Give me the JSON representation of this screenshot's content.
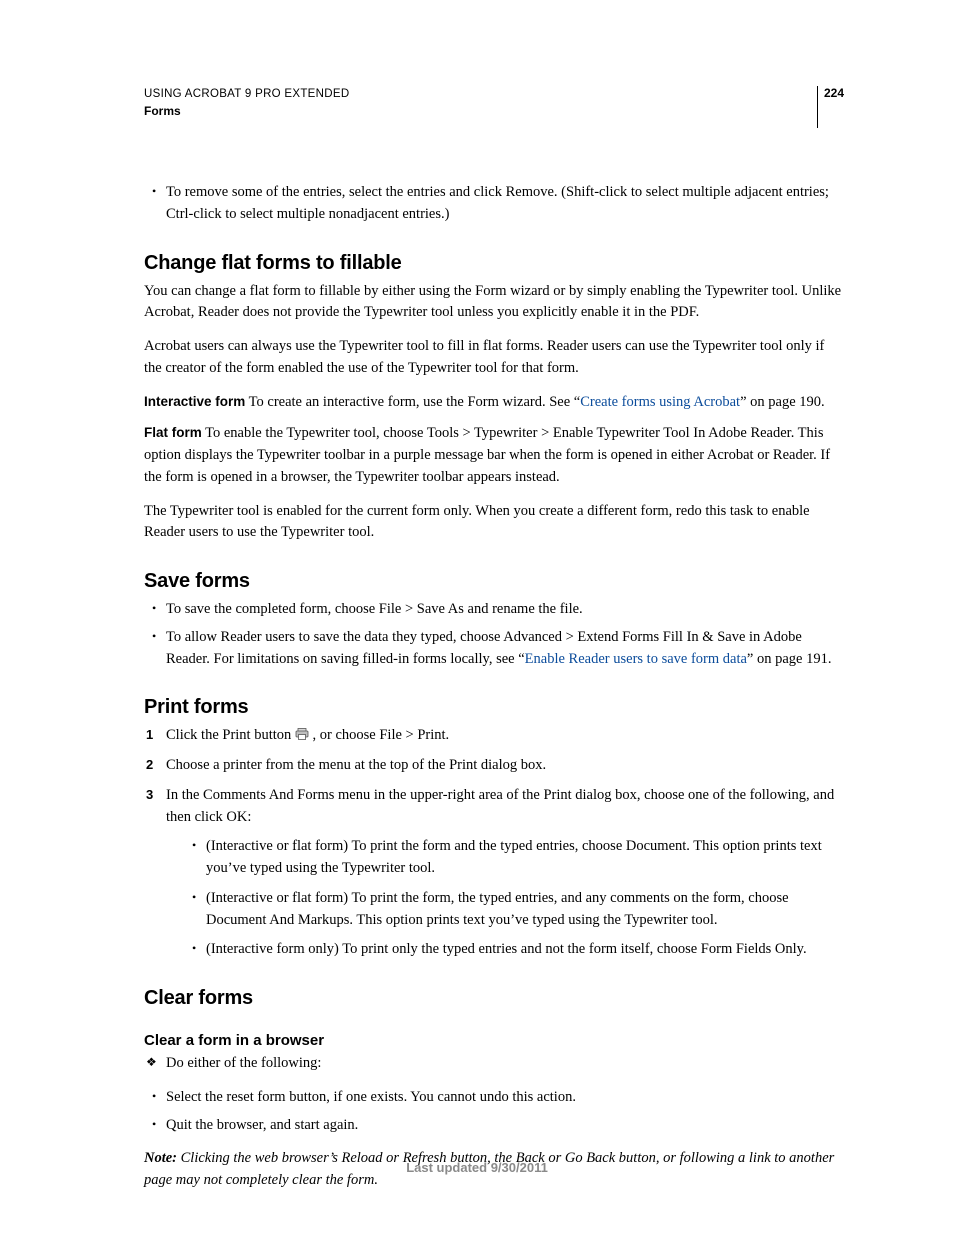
{
  "header": {
    "title": "USING ACROBAT 9 PRO EXTENDED",
    "section": "Forms",
    "page_number": "224"
  },
  "intro_bullet": "To remove some of the entries, select the entries and click Remove. (Shift-click to select multiple adjacent entries; Ctrl-click to select multiple nonadjacent entries.)",
  "s1": {
    "heading": "Change flat forms to fillable",
    "p1": "You can change a flat form to fillable by either using the Form wizard or by simply enabling the Typewriter tool. Unlike Acrobat, Reader does not provide the Typewriter tool unless you explicitly enable it in the PDF.",
    "p2": "Acrobat users can always use the Typewriter tool to fill in flat forms. Reader users can use the Typewriter tool only if the creator of the form enabled the use of the Typewriter tool for that form.",
    "interactive_label": "Interactive form",
    "interactive_pre": "To create an interactive form, use the Form wizard. See “",
    "interactive_link": "Create forms using Acrobat",
    "interactive_post": "” on page 190.",
    "flat_label": "Flat form",
    "flat_body": "To enable the Typewriter tool, choose Tools > Typewriter > Enable Typewriter Tool In Adobe Reader. This option displays the Typewriter toolbar in a purple message bar when the form is opened in either Acrobat or Reader. If the form is opened in a browser, the Typewriter toolbar appears instead.",
    "p3": "The Typewriter tool is enabled for the current form only. When you create a different form, redo this task to enable Reader users to use the Typewriter tool."
  },
  "s2": {
    "heading": "Save forms",
    "b1": "To save the completed form, choose File > Save As and rename the file.",
    "b2_pre": "To allow Reader users to save the data they typed, choose Advanced > Extend Forms Fill In & Save in Adobe Reader. For limitations on saving filled-in forms locally, see “",
    "b2_link": "Enable Reader users to save form data",
    "b2_post": "” on page 191."
  },
  "s3": {
    "heading": "Print forms",
    "n1_pre": "Click the Print button ",
    "n1_post": " , or choose File > Print.",
    "n2": "Choose a printer from the menu at the top of the Print dialog box.",
    "n3": "In the Comments And Forms menu in the upper-right area of the Print dialog box, choose one of the following, and then click OK:",
    "sub1": "(Interactive or flat form) To print the form and the typed entries, choose Document. This option prints text you’ve typed using the Typewriter tool.",
    "sub2": "(Interactive or flat form) To print the form, the typed entries, and any comments on the form, choose Document And Markups. This option prints text you’ve typed using the Typewriter tool.",
    "sub3": "(Interactive form only) To print only the typed entries and not the form itself, choose Form Fields Only."
  },
  "s4": {
    "heading": "Clear forms",
    "sub_heading": "Clear a form in a browser",
    "d1": "Do either of the following:",
    "b1": "Select the reset form button, if one exists. You cannot undo this action.",
    "b2": "Quit the browser, and start again.",
    "note_label": "Note:",
    "note_body": " Clicking the web browser’s Reload or Refresh button, the Back or Go Back button, or following a link to another page may not completely clear the form."
  },
  "footer": "Last updated 9/30/2011"
}
